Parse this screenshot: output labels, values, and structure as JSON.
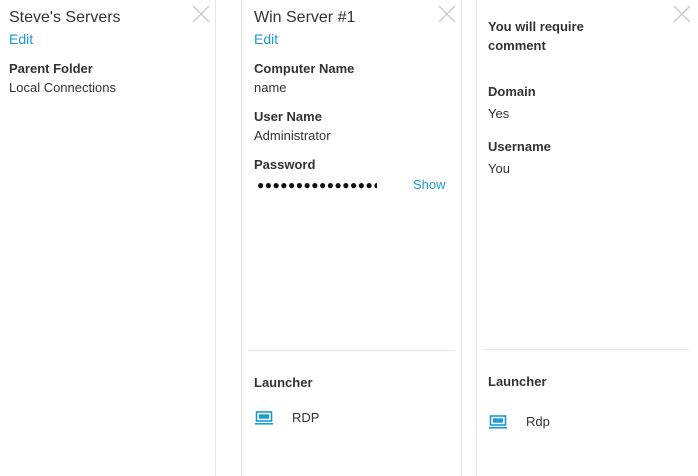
{
  "panels": [
    {
      "title": "Steve's Servers",
      "edit_label": "Edit",
      "fields": [
        {
          "label": "Parent Folder",
          "value": "Local Connections"
        }
      ]
    },
    {
      "title": "Win Server #1",
      "edit_label": "Edit",
      "fields": [
        {
          "label": "Computer Name",
          "value": "name"
        },
        {
          "label": "User Name",
          "value": "Administrator"
        },
        {
          "label": "Password",
          "value": "●●●●●●●●●●●●●●●●"
        }
      ],
      "show_label": "Show",
      "launcher": {
        "heading": "Launcher",
        "item": "RDP",
        "icon": "monitor-icon"
      }
    },
    {
      "notice": "You will require comment",
      "fields": [
        {
          "label": "Domain",
          "value": "Yes"
        },
        {
          "label": "Username",
          "value": "You"
        }
      ],
      "launcher": {
        "heading": "Launcher",
        "item": "Rdp",
        "icon": "monitor-icon"
      }
    }
  ],
  "colors": {
    "link": "#1a9ad6",
    "text": "#333333",
    "border": "#e6e6e6"
  }
}
